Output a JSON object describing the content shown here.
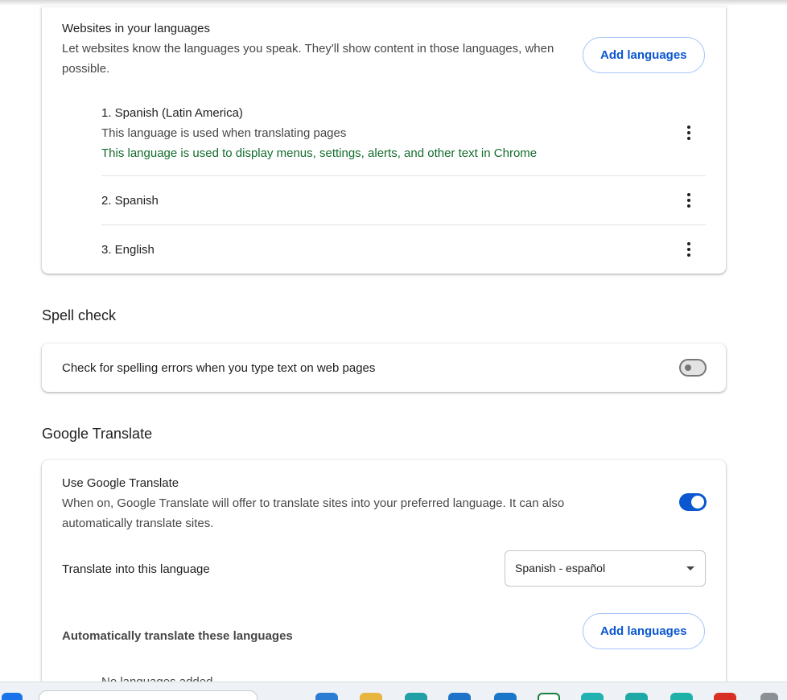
{
  "languages_card": {
    "title": "Websites in your languages",
    "description": "Let websites know the languages you speak. They'll show content in those languages, when possible.",
    "add_button": "Add languages",
    "items": [
      {
        "label": "1. Spanish (Latin America)",
        "note": "This language is used when translating pages",
        "ui_note": "This language is used to display menus, settings, alerts, and other text in Chrome"
      },
      {
        "label": "2. Spanish"
      },
      {
        "label": "3. English"
      }
    ]
  },
  "spell_check": {
    "heading": "Spell check",
    "label": "Check for spelling errors when you type text on web pages",
    "enabled": false
  },
  "google_translate": {
    "heading": "Google Translate",
    "use_title": "Use Google Translate",
    "use_description": "When on, Google Translate will offer to translate sites into your preferred language. It can also automatically translate sites.",
    "enabled": true,
    "translate_into_label": "Translate into this language",
    "translate_into_value": "Spanish - español",
    "auto_translate_label": "Automatically translate these languages",
    "add_button": "Add languages",
    "empty_text": "No languages added"
  },
  "colors": {
    "accent": "#0b57d0",
    "green_note": "#146c2e"
  }
}
